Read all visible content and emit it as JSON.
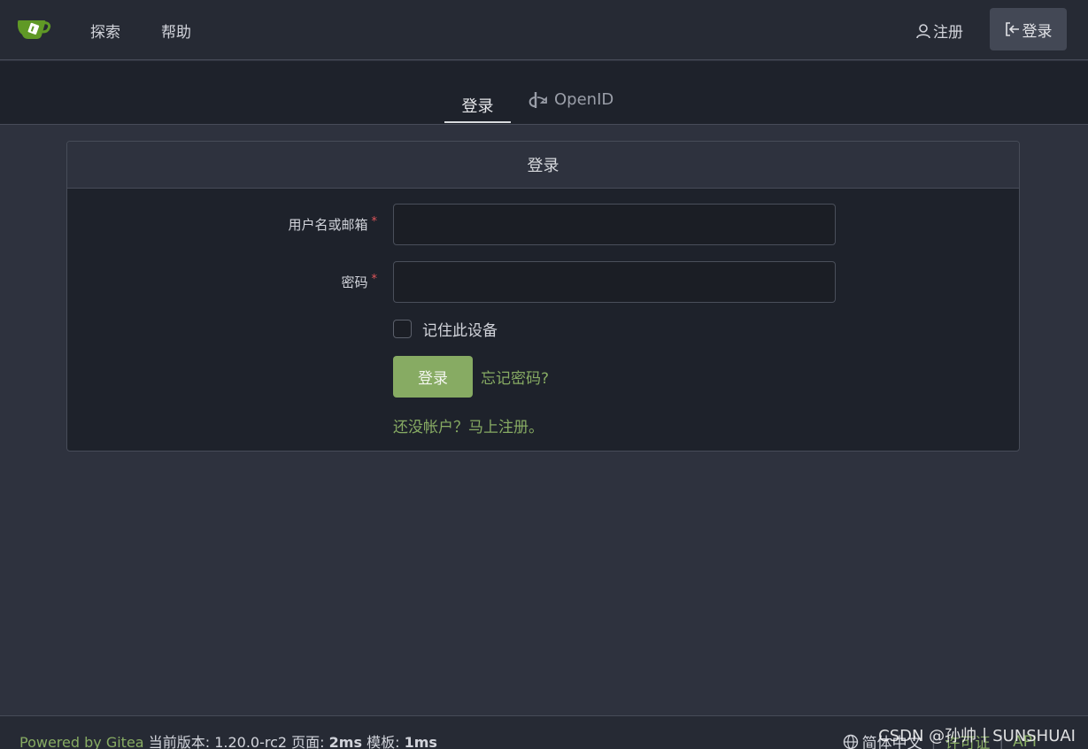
{
  "nav": {
    "explore": "探索",
    "help": "帮助",
    "register": "注册",
    "login": "登录"
  },
  "tabs": [
    {
      "label": "登录",
      "active": true
    },
    {
      "label": "OpenID",
      "active": false
    }
  ],
  "card": {
    "title": "登录",
    "username_label": "用户名或邮箱",
    "password_label": "密码",
    "required_mark": "*",
    "username_value": "",
    "password_value": "",
    "remember_label": "记住此设备",
    "submit_label": "登录",
    "forgot_label": "忘记密码?",
    "signup_label": "还没帐户？马上注册。"
  },
  "footer": {
    "powered": "Powered by Gitea",
    "version_label": "当前版本:",
    "version": "1.20.0-rc2",
    "page_label": "页面:",
    "page_time": "2ms",
    "template_label": "模板:",
    "template_time": "1ms",
    "language": "简体中文",
    "license": "许可证",
    "api": "API"
  },
  "watermark": "CSDN @孙帅丨SUNSHUAI",
  "colors": {
    "accent": "#87ab63",
    "background": "#2e323e",
    "header": "#262a34",
    "required": "#e0555a"
  },
  "icons": {
    "logo": "gitea-logo",
    "register": "person-icon",
    "login": "sign-in-icon",
    "openid": "openid-icon",
    "language": "globe-icon"
  }
}
